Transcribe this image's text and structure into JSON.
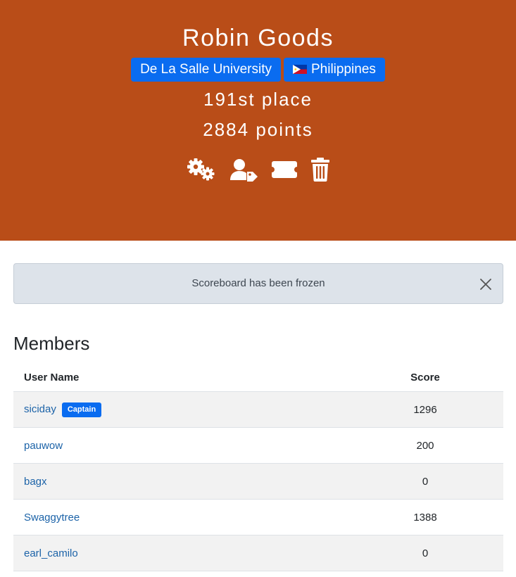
{
  "team": {
    "name": "Robin Goods",
    "affiliation": "De La Salle University",
    "country": "Philippines",
    "place": "191st place",
    "points": "2884 points"
  },
  "toolbar": {
    "icons": [
      "settings-gears-icon",
      "user-tag-icon",
      "ticket-icon",
      "trash-icon"
    ]
  },
  "alert": {
    "message": "Scoreboard has been frozen"
  },
  "members": {
    "heading": "Members",
    "columns": [
      "User Name",
      "Score"
    ],
    "captain_label": "Captain",
    "rows": [
      {
        "name": "siciday",
        "score": "1296",
        "captain": true
      },
      {
        "name": "pauwow",
        "score": "200"
      },
      {
        "name": "bagx",
        "score": "0"
      },
      {
        "name": "Swaggytree",
        "score": "1388"
      },
      {
        "name": "earl_camilo",
        "score": "0"
      }
    ]
  },
  "colors": {
    "header_bg": "#b94d18",
    "badge_blue": "#0a6cf0",
    "link": "#1c63a8",
    "alert_bg": "#dde3ea"
  }
}
